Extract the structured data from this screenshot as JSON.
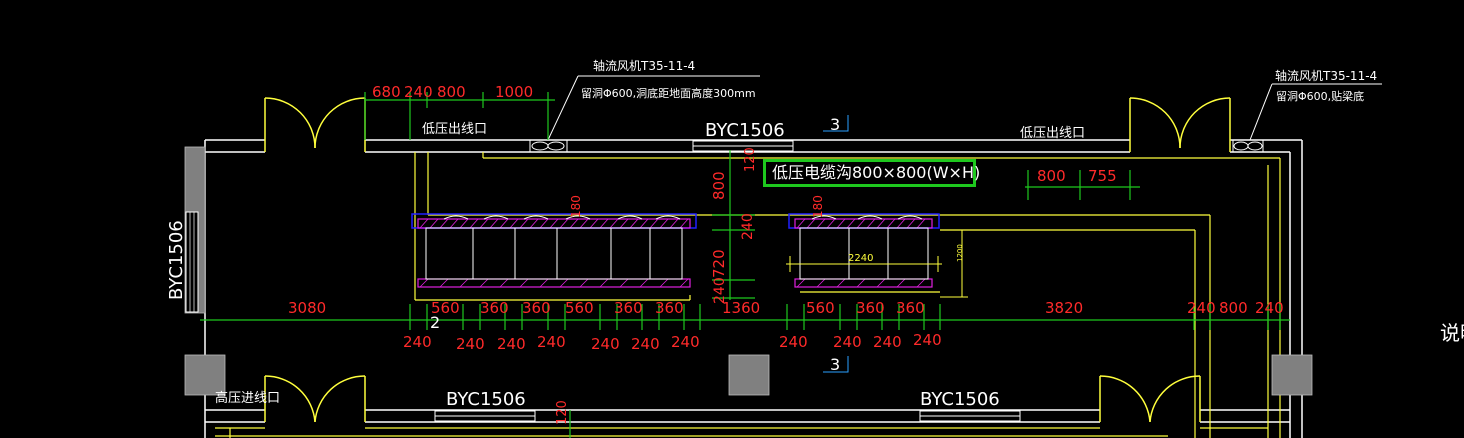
{
  "labels": {
    "fan_left_title": "轴流风机T35-11-4",
    "fan_left_note": "留洞Φ600,洞底距地面高度300mm",
    "fan_right_title": "轴流风机T35-11-4",
    "fan_right_note": "留洞Φ600,贴梁底",
    "window_top": "BYC1506",
    "window_left": "BYC1506",
    "window_bottom_left": "BYC1506",
    "window_bottom_right": "BYC1506",
    "lv_outlet_left": "低压出线口",
    "lv_outlet_right": "低压出线口",
    "hv_inlet": "高压进线口",
    "cable_trench": "低压电缆沟800×800(W×H)",
    "section_top": "3",
    "section_bottom": "3",
    "axis_2": "2",
    "side_note": "说明"
  },
  "dimensions": {
    "top_row": [
      "680",
      "240",
      "800",
      "1000"
    ],
    "right_top": [
      "800",
      "755"
    ],
    "vertical_mid": [
      "800",
      "240",
      "720",
      "240"
    ],
    "v_120_top": "120",
    "v_120_bottom": "120",
    "small_180_left": "180",
    "small_180_right": "180",
    "inner_2240": "2240",
    "inner_1200": "1200",
    "axis_row": [
      "3080",
      "560",
      "360",
      "360",
      "560",
      "360",
      "360",
      "1360",
      "560",
      "360",
      "360",
      "3820",
      "240",
      "800",
      "240"
    ],
    "bottom_row": [
      "240",
      "240",
      "240",
      "240",
      "240",
      "240",
      "240",
      "240",
      "240",
      "240",
      "240"
    ]
  },
  "colors": {
    "background": "#000000",
    "wall": "#ffffff",
    "wall_yellow": "#ffff3c",
    "dimension_line": "#1ec81e",
    "dimension_text": "#ff2a2a",
    "cabinet_frame": "#2020ff",
    "cabinet_hatch": "#e020e0",
    "column": "#808080"
  }
}
